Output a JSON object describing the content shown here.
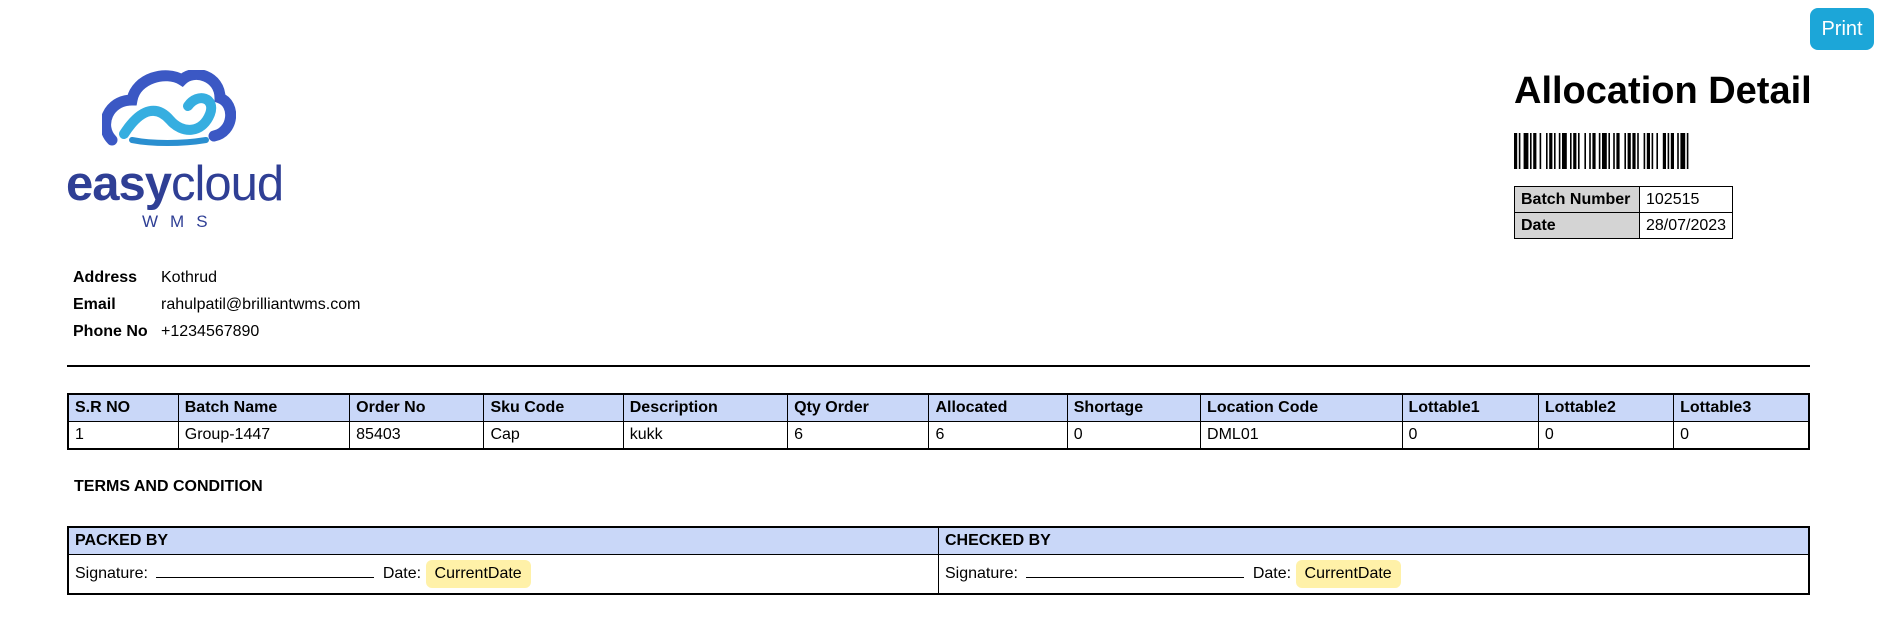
{
  "toolbar": {
    "print_label": "Print"
  },
  "logo": {
    "part1": "easy",
    "part2": "cloud",
    "sub": "WMS"
  },
  "contact": [
    {
      "label": "Address",
      "value": "Kothrud"
    },
    {
      "label": "Email",
      "value": "rahulpatil@brilliantwms.com"
    },
    {
      "label": "Phone No",
      "value": "+1234567890"
    }
  ],
  "header": {
    "title": "Allocation Detail"
  },
  "batch": [
    {
      "label": "Batch Number",
      "value": "102515"
    },
    {
      "label": "Date",
      "value": "28/07/2023"
    }
  ],
  "items": {
    "columns": [
      "S.R NO",
      "Batch Name",
      "Order No",
      "Sku Code",
      "Description",
      "Qty Order",
      "Allocated",
      "Shortage",
      "Location Code",
      "Lottable1",
      "Lottable2",
      "Lottable3"
    ],
    "rows": [
      [
        "1",
        "Group-1447",
        "85403",
        "Cap",
        "kukk",
        "6",
        "6",
        "0",
        "DML01",
        "0",
        "0",
        "0"
      ]
    ]
  },
  "terms": "TERMS AND CONDITION",
  "signoff": {
    "packed_title": "PACKED BY",
    "checked_title": "CHECKED BY",
    "signature_label": "Signature:",
    "date_label": "Date:",
    "date_value": "CurrentDate"
  },
  "colors": {
    "accent": "#1ca6d8",
    "table_header": "#c9d7f8",
    "brand": "#2f3f95",
    "highlight": "#fff1a8"
  }
}
